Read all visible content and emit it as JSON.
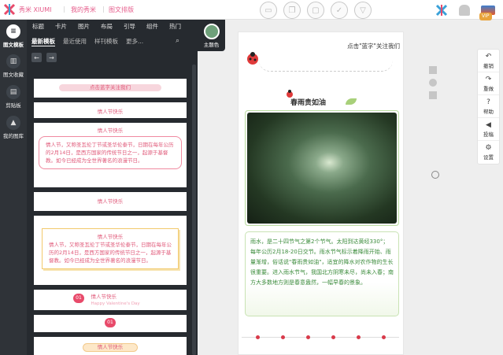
{
  "topbar": {
    "brand": "秀米 XIUMI",
    "crumb1": "我的秀米",
    "crumb2": "图文排版",
    "vip": "VIP"
  },
  "leftnav": [
    {
      "label": "图文模板",
      "icon": "hamburger-icon"
    },
    {
      "label": "图文收藏",
      "icon": "bookmark-icon"
    },
    {
      "label": "剪贴板",
      "icon": "clipboard-icon"
    },
    {
      "label": "我的图库",
      "icon": "image-library-icon"
    }
  ],
  "categories": [
    "标题",
    "卡片",
    "图片",
    "布局",
    "引导",
    "组件",
    "热门"
  ],
  "subtabs": [
    "最新模板",
    "最近使用",
    "样刊模板",
    "更多..."
  ],
  "theme_label": "主题色",
  "templates": {
    "t1": "点击蓝字关注我们",
    "t2": "情人节快乐",
    "t3_title": "情人节快乐",
    "t3_body": "情人节，又称圣瓦伦丁节或圣华伦泰节，日期在每年公历的2月14日，是西方国家的传统节日之一，起源于基督教。如今已经成为全世界著名的浪漫节日。",
    "t4": "情人节快乐",
    "t5_title": "情人节快乐",
    "t5_body": "情人节，又称圣瓦伦丁节或圣华伦泰节，日期在每年公历的2月14日，是西方国家的传统节日之一，起源于基督教。如今已经成为全世界著名的浪漫节日。",
    "t6_num": "01",
    "t6_title": "情人节快乐",
    "t6_sub": "Happy Valentine's Day",
    "t7_num": "01",
    "t8": "情人节快乐"
  },
  "canvas": {
    "follow": "点击\"蓝字\"关注我们",
    "title": "春雨贵如油",
    "body": "雨水，是二十四节气之第2个节气。太阳到达黄经330°；每年公历2月18-20日交节。雨水节气标示着降雨开始、雨量渐增，俗话说\"春雨贵如油\"，适宜的降水对农作物的生长很重要。进入雨水节气，我国北方阴寒未尽，尚未入春；南方大多数地方则是春意盎然，一幅早春的景象。"
  },
  "righttools": [
    {
      "label": "撤销",
      "icon": "undo-icon",
      "glyph": "↶"
    },
    {
      "label": "重做",
      "icon": "redo-icon",
      "glyph": "↷"
    },
    {
      "label": "帮助",
      "icon": "help-icon",
      "glyph": "?"
    },
    {
      "label": "投稿",
      "icon": "send-icon",
      "glyph": "◀"
    },
    {
      "label": "设置",
      "icon": "gear-icon",
      "glyph": "⚙"
    }
  ],
  "colors": {
    "accent": "#e65c8b",
    "nav_bg": "#2f3338",
    "panel_bg": "#262a2f",
    "theme": "#6ea07a"
  }
}
